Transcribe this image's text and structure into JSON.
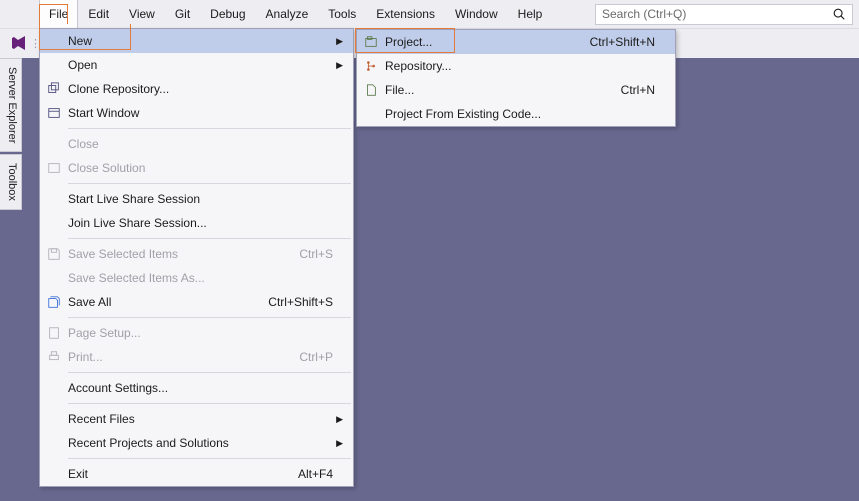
{
  "menubar": [
    "File",
    "Edit",
    "View",
    "Git",
    "Debug",
    "Analyze",
    "Tools",
    "Extensions",
    "Window",
    "Help"
  ],
  "search": {
    "placeholder": "Search (Ctrl+Q)"
  },
  "sidetabs": [
    "Server Explorer",
    "Toolbox"
  ],
  "file_menu": [
    {
      "type": "item",
      "label": "New",
      "shortcut": "",
      "icon": "",
      "arrow": true,
      "disabled": false,
      "highlight": true
    },
    {
      "type": "item",
      "label": "Open",
      "shortcut": "",
      "icon": "",
      "arrow": true,
      "disabled": false
    },
    {
      "type": "item",
      "label": "Clone Repository...",
      "shortcut": "",
      "icon": "clone-icon",
      "arrow": false,
      "disabled": false
    },
    {
      "type": "item",
      "label": "Start Window",
      "shortcut": "",
      "icon": "window-icon",
      "arrow": false,
      "disabled": false
    },
    {
      "type": "sep"
    },
    {
      "type": "item",
      "label": "Close",
      "shortcut": "",
      "icon": "",
      "arrow": false,
      "disabled": true
    },
    {
      "type": "item",
      "label": "Close Solution",
      "shortcut": "",
      "icon": "close-solution-icon",
      "arrow": false,
      "disabled": true
    },
    {
      "type": "sep"
    },
    {
      "type": "item",
      "label": "Start Live Share Session",
      "shortcut": "",
      "icon": "",
      "arrow": false,
      "disabled": false
    },
    {
      "type": "item",
      "label": "Join Live Share Session...",
      "shortcut": "",
      "icon": "",
      "arrow": false,
      "disabled": false
    },
    {
      "type": "sep"
    },
    {
      "type": "item",
      "label": "Save Selected Items",
      "shortcut": "Ctrl+S",
      "icon": "save-icon",
      "arrow": false,
      "disabled": true
    },
    {
      "type": "item",
      "label": "Save Selected Items As...",
      "shortcut": "",
      "icon": "",
      "arrow": false,
      "disabled": true
    },
    {
      "type": "item",
      "label": "Save All",
      "shortcut": "Ctrl+Shift+S",
      "icon": "saveall-icon",
      "arrow": false,
      "disabled": false
    },
    {
      "type": "sep"
    },
    {
      "type": "item",
      "label": "Page Setup...",
      "shortcut": "",
      "icon": "pagesetup-icon",
      "arrow": false,
      "disabled": true
    },
    {
      "type": "item",
      "label": "Print...",
      "shortcut": "Ctrl+P",
      "icon": "print-icon",
      "arrow": false,
      "disabled": true
    },
    {
      "type": "sep"
    },
    {
      "type": "item",
      "label": "Account Settings...",
      "shortcut": "",
      "icon": "",
      "arrow": false,
      "disabled": false
    },
    {
      "type": "sep"
    },
    {
      "type": "item",
      "label": "Recent Files",
      "shortcut": "",
      "icon": "",
      "arrow": true,
      "disabled": false
    },
    {
      "type": "item",
      "label": "Recent Projects and Solutions",
      "shortcut": "",
      "icon": "",
      "arrow": true,
      "disabled": false
    },
    {
      "type": "sep"
    },
    {
      "type": "item",
      "label": "Exit",
      "shortcut": "Alt+F4",
      "icon": "",
      "arrow": false,
      "disabled": false
    }
  ],
  "new_submenu": [
    {
      "label": "Project...",
      "shortcut": "Ctrl+Shift+N",
      "icon": "project-icon",
      "highlight": true
    },
    {
      "label": "Repository...",
      "shortcut": "",
      "icon": "repo-icon"
    },
    {
      "label": "File...",
      "shortcut": "Ctrl+N",
      "icon": "file-icon"
    },
    {
      "label": "Project From Existing Code...",
      "shortcut": "",
      "icon": ""
    }
  ]
}
